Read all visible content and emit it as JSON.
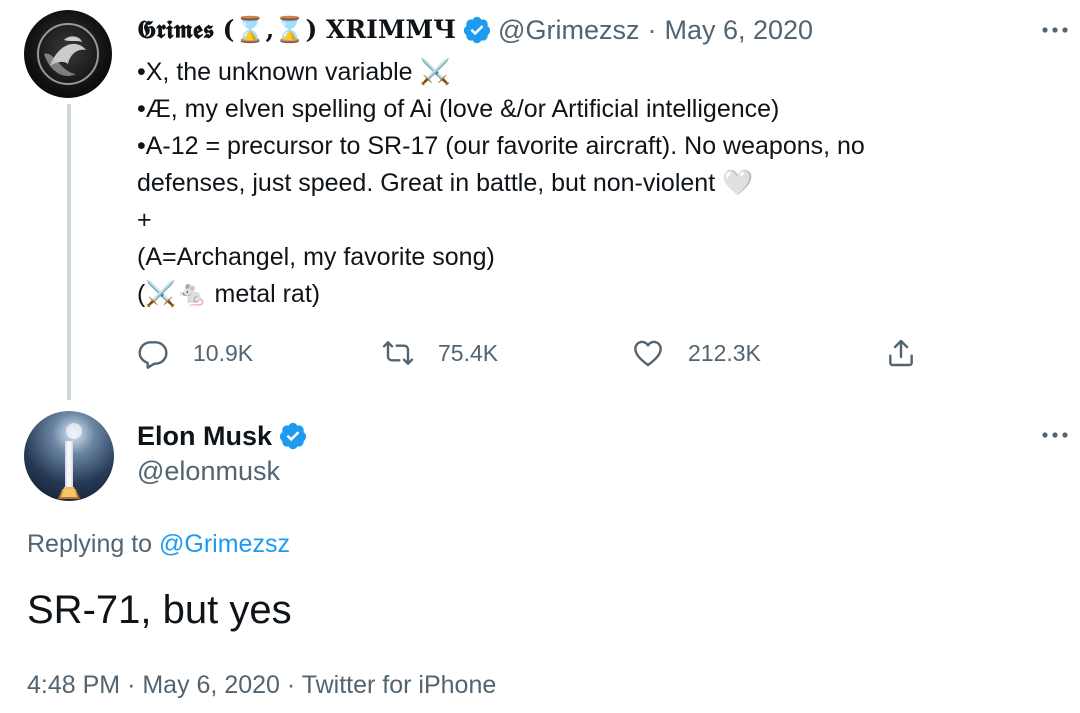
{
  "original_tweet": {
    "display_name": "𝕲𝖗𝖎𝖒𝖊𝖘 (⌛,⌛) XRIMMЧ",
    "handle": "@Grimezsz",
    "separator": "·",
    "date": "May 6, 2020",
    "lines": [
      "•X, the unknown variable ⚔️",
      "•Æ, my elven spelling of Ai (love &/or Artificial intelligence)",
      "•A-12 = precursor to SR-17 (our favorite aircraft).  No weapons, no",
      "defenses, just speed.  Great in battle, but non-violent 🤍",
      "+",
      "(A=Archangel, my favorite song)",
      "(⚔️🐁 metal rat)"
    ],
    "stats": {
      "replies": "10.9K",
      "retweets": "75.4K",
      "likes": "212.3K"
    }
  },
  "reply_tweet": {
    "display_name": "Elon Musk",
    "handle": "@elonmusk",
    "replying_prefix": "Replying to",
    "replying_to": "@Grimezsz",
    "text": "SR-71, but yes",
    "time": "4:48 PM",
    "separator": "·",
    "date": "May 6, 2020",
    "source": "Twitter for iPhone"
  },
  "colors": {
    "verified_blue": "#1d9bf0",
    "secondary_text": "#536471",
    "primary_text": "#0f1419",
    "thread_line": "#cfd9de"
  },
  "icons": {
    "reply": "reply-icon",
    "retweet": "retweet-icon",
    "like": "heart-icon",
    "share": "share-icon",
    "more": "more-icon",
    "verified": "verified-badge-icon"
  }
}
